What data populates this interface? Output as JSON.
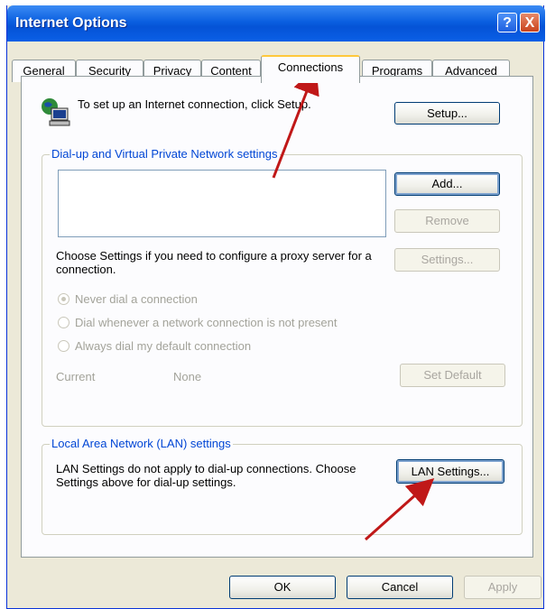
{
  "window": {
    "title": "Internet Options"
  },
  "titlebar_buttons": {
    "help": "?",
    "close": "X"
  },
  "tabs": [
    {
      "label": "General"
    },
    {
      "label": "Security"
    },
    {
      "label": "Privacy"
    },
    {
      "label": "Content"
    },
    {
      "label": "Connections",
      "active": true
    },
    {
      "label": "Programs"
    },
    {
      "label": "Advanced"
    }
  ],
  "setup_section": {
    "text": "To set up an Internet connection, click Setup.",
    "setup_button": "Setup..."
  },
  "dialup_group": {
    "legend": "Dial-up and Virtual Private Network settings",
    "add_button": "Add...",
    "remove_button": "Remove",
    "proxy_text": "Choose Settings if you need to configure a proxy server for a connection.",
    "settings_button": "Settings...",
    "radios": [
      {
        "label": "Never dial a connection",
        "checked": true
      },
      {
        "label": "Dial whenever a network connection is not present",
        "checked": false
      },
      {
        "label": "Always dial my default connection",
        "checked": false
      }
    ],
    "current_label": "Current",
    "current_value": "None",
    "set_default_button": "Set Default"
  },
  "lan_group": {
    "legend": "Local Area Network (LAN) settings",
    "text": "LAN Settings do not apply to dial-up connections. Choose Settings above for dial-up settings.",
    "lan_settings_button": "LAN Settings..."
  },
  "footer": {
    "ok": "OK",
    "cancel": "Cancel",
    "apply": "Apply"
  },
  "colors": {
    "titlebar": "#0a5fe0",
    "face": "#ece9d8",
    "annotation_arrow": "#c01818"
  }
}
